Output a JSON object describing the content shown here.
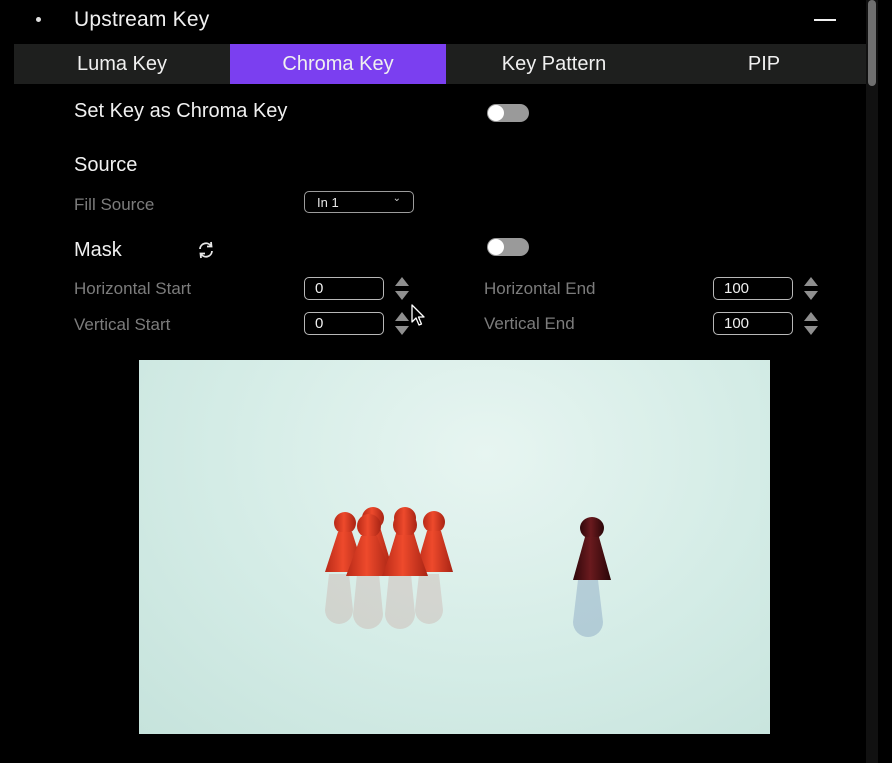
{
  "header": {
    "title": "Upstream Key"
  },
  "tabs": [
    {
      "label": "Luma Key",
      "active": false
    },
    {
      "label": "Chroma Key",
      "active": true
    },
    {
      "label": "Key Pattern",
      "active": false
    },
    {
      "label": "PIP",
      "active": false
    }
  ],
  "chroma": {
    "set_key_label": "Set Key as Chroma Key",
    "set_key_enabled": false,
    "source_label": "Source",
    "fill_source_label": "Fill Source",
    "fill_source_value": "In 1"
  },
  "mask": {
    "label": "Mask",
    "enabled": false,
    "horizontal_start_label": "Horizontal Start",
    "horizontal_start_value": "0",
    "horizontal_end_label": "Horizontal End",
    "horizontal_end_value": "100",
    "vertical_start_label": "Vertical Start",
    "vertical_start_value": "0",
    "vertical_end_label": "Vertical End",
    "vertical_end_value": "100"
  },
  "colors": {
    "accent": "#7b3ff0",
    "tab_bar": "#1e1f1e",
    "background": "#000000",
    "muted_text": "#7c7c7c",
    "preview_bg": "#d4ece6",
    "pawn_red": "#d93a22",
    "pawn_dark": "#4a0f12"
  },
  "icons": {
    "collapse": "minus-icon",
    "mask_reset": "refresh-icon",
    "select_chevron": "chevron-down-icon"
  }
}
